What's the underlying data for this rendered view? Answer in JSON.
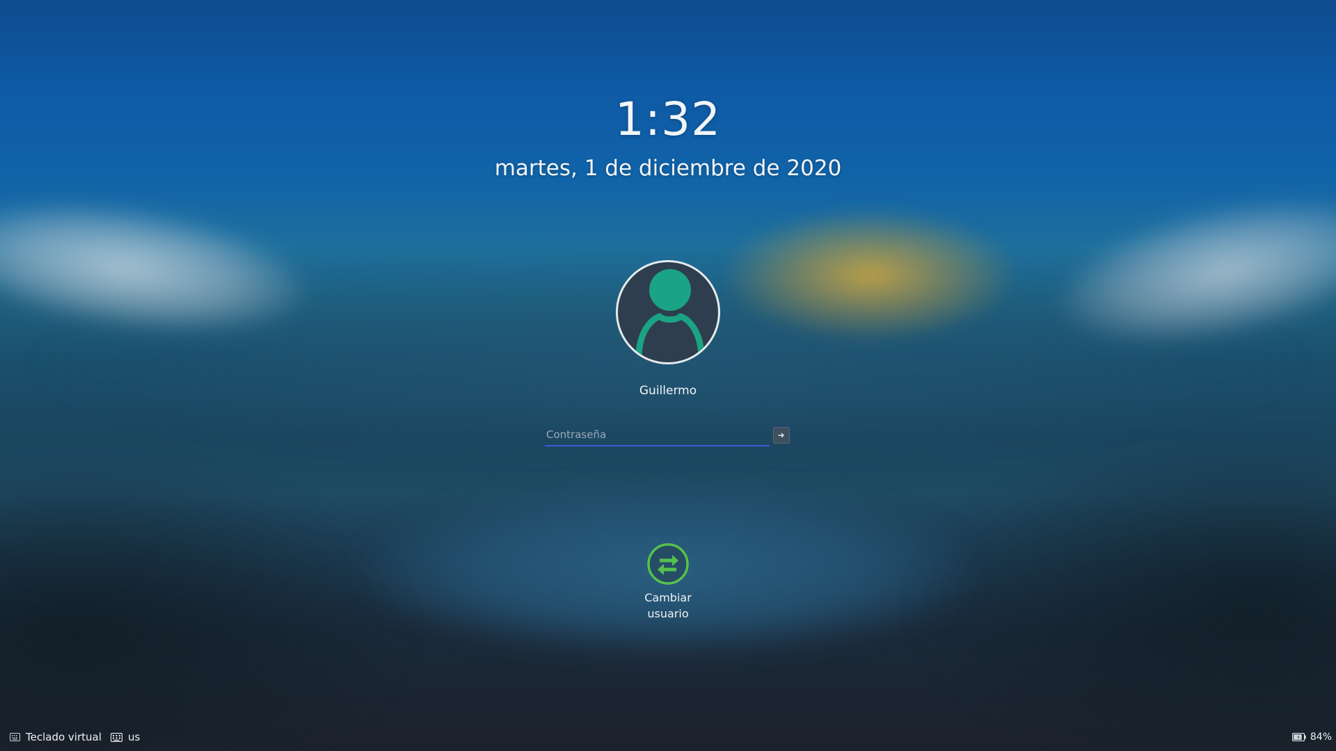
{
  "clock": {
    "time": "1:32",
    "date": "martes, 1 de diciembre de 2020"
  },
  "user": {
    "name": "Guillermo",
    "avatar_icon": "user-avatar-icon"
  },
  "login": {
    "password_placeholder": "Contraseña",
    "password_value": "",
    "submit_icon": "arrow-right-icon"
  },
  "actions": {
    "switch_user_label": "Cambiar\nusuario",
    "switch_user_icon": "switch-user-icon"
  },
  "bottom_bar": {
    "virtual_keyboard_label": "Teclado virtual",
    "virtual_keyboard_icon": "keyboard-icon",
    "layout_label": "us",
    "layout_icon": "keyboard-icon",
    "battery_label": "84%",
    "battery_icon": "battery-charging-icon",
    "battery_level": 0.84
  },
  "colors": {
    "accent": "#3d5bd9",
    "avatar_teal": "#1aa384",
    "switch_user_green": "#55c24a"
  }
}
